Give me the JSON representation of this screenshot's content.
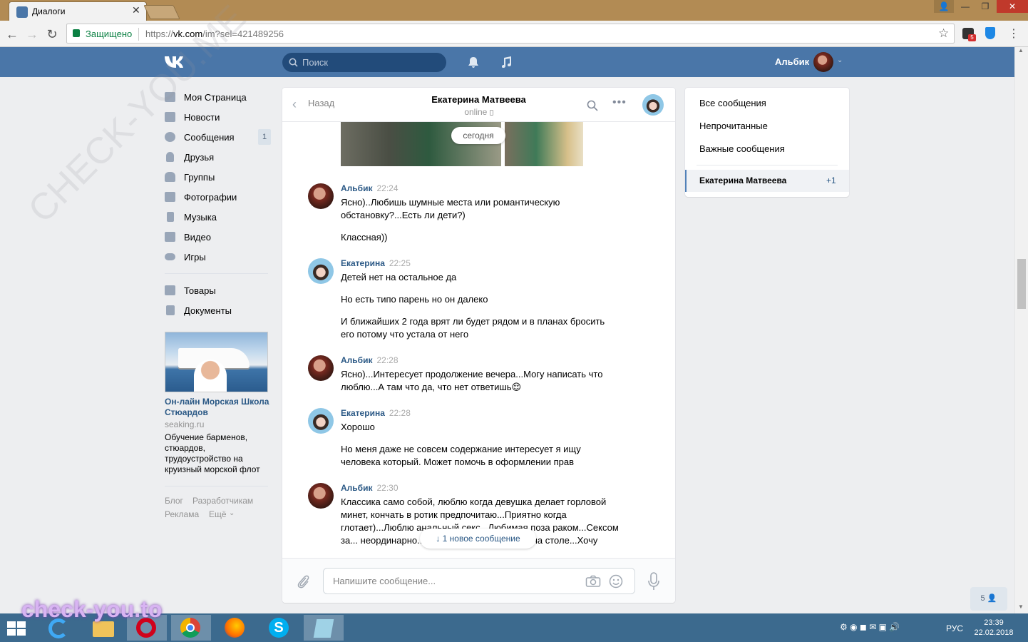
{
  "browser": {
    "tab_title": "Диалоги",
    "secure_label": "Защищено",
    "url_scheme": "https://",
    "url_host": "vk.com",
    "url_path": "/im?sel=421489256",
    "ext_badge": "5"
  },
  "header": {
    "search_placeholder": "Поиск",
    "user_name": "Альбик"
  },
  "menu": {
    "items": [
      {
        "label": "Моя Страница"
      },
      {
        "label": "Новости"
      },
      {
        "label": "Сообщения",
        "badge": "1"
      },
      {
        "label": "Друзья"
      },
      {
        "label": "Группы"
      },
      {
        "label": "Фотографии"
      },
      {
        "label": "Музыка"
      },
      {
        "label": "Видео"
      },
      {
        "label": "Игры"
      }
    ],
    "extra": [
      {
        "label": "Товары"
      },
      {
        "label": "Документы"
      }
    ]
  },
  "ad": {
    "title": "Он-лайн Морская Школа Стюардов",
    "domain": "seaking.ru",
    "description": "Обучение барменов, стюардов, трудоустройство на круизный морской флот"
  },
  "footer_links": [
    "Блог",
    "Разработчикам",
    "Реклама",
    "Ещё"
  ],
  "chat": {
    "back_label": "Назад",
    "contact_name": "Екатерина Матвеева",
    "status": "online",
    "date_separator": "сегодня",
    "messages": [
      {
        "author": "Альбик",
        "time": "22:24",
        "texts": [
          "Ясно)..Любишь шумные места или романтическую обстановку?...Есть ли дети?)",
          "Классная))"
        ]
      },
      {
        "author": "Екатерина",
        "time": "22:25",
        "texts": [
          "Детей нет на остальное да",
          "Но есть типо парень но он далеко",
          "И ближайших 2 года врят ли будет рядом и в планах бросить его потому что устала от него"
        ]
      },
      {
        "author": "Альбик",
        "time": "22:28",
        "texts": [
          "Ясно)...Интересует продолжение вечера...Могу написать что люблю...А там что да, что нет ответишь😌"
        ]
      },
      {
        "author": "Екатерина",
        "time": "22:28",
        "texts": [
          "Хорошо",
          "Но меня даже не совсем содержание интересует я ищу человека который. Может помочь в оформлении прав"
        ]
      },
      {
        "author": "Альбик",
        "time": "22:30",
        "texts": [
          "Классика само собой, люблю когда девушка делает горловой минет, кончать в ротик предпочитаю...Приятно когда глотает)...Люблю анальный секс...Любимая поза раком...Сексом за... неординарно...Тобишь в кресле, лифте,на столе...Хочу"
        ]
      }
    ],
    "new_message_label": "1 новое сообщение",
    "input_placeholder": "Напишите сообщение..."
  },
  "right_panel": {
    "items": [
      "Все сообщения",
      "Непрочитанные",
      "Важные сообщения"
    ],
    "active_dialog": "Екатерина Матвеева",
    "active_count": "+1"
  },
  "friends_online": "5",
  "taskbar": {
    "lang": "РУС",
    "time": "23:39",
    "date": "22.02.2018"
  },
  "watermark": {
    "bottom": "check-you.to",
    "diagonal": "CHECK-YOU.ME"
  },
  "colors": {
    "vk_blue": "#4a76a8",
    "link_blue": "#2a5885",
    "taskbar": "#3c6a8e",
    "browser_frame": "#b28b54"
  }
}
